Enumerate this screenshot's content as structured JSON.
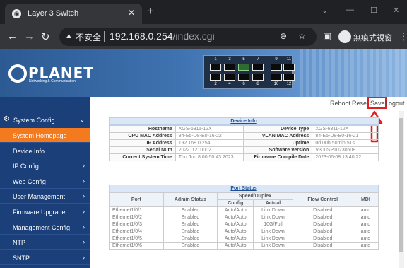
{
  "browser": {
    "tab_title": "Layer 3 Switch",
    "insecure_label": "不安全",
    "url_host": "192.168.0.254",
    "url_path": "/index.cgi",
    "incognito_label": "無痕式視窗"
  },
  "brand": {
    "logo_text": "PLANET",
    "logo_sub": "Networking & Communication"
  },
  "switch_ports": {
    "top_row": [
      "1",
      "3",
      "5",
      "7",
      "9",
      "11"
    ],
    "bottom_row": [
      "2",
      "4",
      "6",
      "8",
      "10",
      "12"
    ],
    "active_port": "5"
  },
  "sidebar": {
    "group": "System Config",
    "items": [
      {
        "label": "System Homepage",
        "active": true,
        "arrow": ""
      },
      {
        "label": "Device Info",
        "arrow": ""
      },
      {
        "label": "IP Config",
        "arrow": "›"
      },
      {
        "label": "Web Config",
        "arrow": "›"
      },
      {
        "label": "User Management",
        "arrow": "›"
      },
      {
        "label": "Firmware Upgrade",
        "arrow": "›"
      },
      {
        "label": "Management Config",
        "arrow": "›"
      },
      {
        "label": "NTP",
        "arrow": "›"
      },
      {
        "label": "SNTP",
        "arrow": "›"
      }
    ]
  },
  "toolbar": {
    "reboot": "Reboot",
    "reset": "Reset",
    "save": "Save",
    "logout": "Logout"
  },
  "device_info": {
    "title": "Device Info",
    "rows": [
      {
        "l1": "Hostname",
        "v1": "XGS-6311-12X",
        "l2": "Device Type",
        "v2": "XGS-6311-12X"
      },
      {
        "l1": "CPU MAC Address",
        "v1": "84-E5-D8-E0-16-22",
        "l2": "VLAN MAC Address",
        "v2": "84-E5-D8-E0-16-21"
      },
      {
        "l1": "IP Address",
        "v1": "192.168.0.254",
        "l2": "Uptime",
        "v2": "0d 00h 50min 51s"
      },
      {
        "l1": "Serial Num",
        "v1": "202211210002",
        "l2": "Software Version",
        "v2": "V300SP10230608"
      },
      {
        "l1": "Current System Time",
        "v1": "Thu Jun 8 00:50:43 2023",
        "l2": "Firmware Compile Date",
        "v2": "2023-06-08 13:40:22"
      }
    ]
  },
  "port_status": {
    "title": "Port Status",
    "headers": {
      "port": "Port",
      "admin": "Admin Status",
      "speed": "Speed/Duplex",
      "config": "Config",
      "actual": "Actual",
      "flow": "Flow Control",
      "mdi": "MDI"
    },
    "rows": [
      [
        "Ethernet1/0/1",
        "Enabled",
        "Auto/Auto",
        "Link Down",
        "Disabled",
        "auto"
      ],
      [
        "Ethernet1/0/2",
        "Enabled",
        "Auto/Auto",
        "Link Down",
        "Disabled",
        "auto"
      ],
      [
        "Ethernet1/0/3",
        "Enabled",
        "Auto/Auto",
        "10G/Full",
        "Disabled",
        "auto"
      ],
      [
        "Ethernet1/0/4",
        "Enabled",
        "Auto/Auto",
        "Link Down",
        "Disabled",
        "auto"
      ],
      [
        "Ethernet1/0/5",
        "Enabled",
        "Auto/Auto",
        "Link Down",
        "Disabled",
        "auto"
      ],
      [
        "Ethernet1/0/6",
        "Enabled",
        "Auto/Auto",
        "Link Down",
        "Disabled",
        "auto"
      ]
    ]
  },
  "colors": {
    "sidebar_bg": "#1b3f78",
    "active_item": "#f47a20",
    "highlight": "#e02020"
  }
}
